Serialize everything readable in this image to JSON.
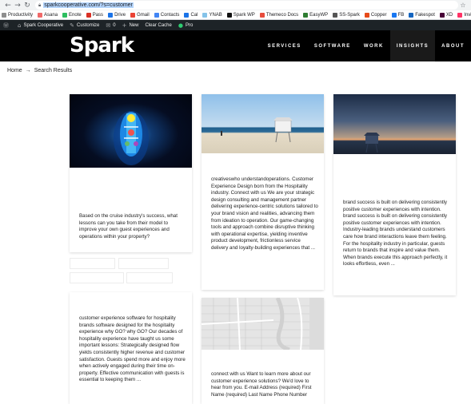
{
  "browser": {
    "url": "sparkcooperative.com/?s=customer"
  },
  "bookmarks": [
    {
      "label": "Productivity",
      "color": "#8e8e8e"
    },
    {
      "label": "Asana",
      "color": "#f06a6a"
    },
    {
      "label": "Enote",
      "color": "#2dbe60"
    },
    {
      "label": "Pass",
      "color": "#d93025"
    },
    {
      "label": "Drive",
      "color": "#1a73e8"
    },
    {
      "label": "Gmail",
      "color": "#ea4335"
    },
    {
      "label": "Contacts",
      "color": "#4285f4"
    },
    {
      "label": "Cal",
      "color": "#1a73e8"
    },
    {
      "label": "YNAB",
      "color": "#85c3e9"
    },
    {
      "label": "Spark WP",
      "color": "#111111"
    },
    {
      "label": "Themeco Docs",
      "color": "#e74c3c"
    },
    {
      "label": "EasyWP",
      "color": "#2e7d32"
    },
    {
      "label": "SS-Spark",
      "color": "#555555"
    },
    {
      "label": "Copper",
      "color": "#e64a19"
    },
    {
      "label": "FB",
      "color": "#1877f2"
    },
    {
      "label": "Fakespot",
      "color": "#1565c0"
    },
    {
      "label": "XD",
      "color": "#470137"
    },
    {
      "label": "Invision",
      "color": "#ff3366"
    }
  ],
  "adminbar": {
    "site": "Spark Cooperative",
    "customize": "Customize",
    "comments": "0",
    "new": "New",
    "clear_cache": "Clear Cache",
    "pro": "Pro"
  },
  "site": {
    "logo": "Spark",
    "nav": [
      "SERVICES",
      "SOFTWARE",
      "WORK",
      "INSIGHTS",
      "ABOUT"
    ],
    "active_nav": "INSIGHTS"
  },
  "breadcrumb": {
    "home": "Home",
    "sep": "→",
    "current": "Search Results"
  },
  "cards": {
    "c1": "Based on the cruise industry's success, what lessons can you take from their model to improve your own guest experiences and operations within your property?",
    "c2": "creativeswho understandoperations.  Customer Experience Design born from the Hospitality industry. Connect with us We are your strategic design consulting and management partner delivering experience-centric solutions tailored to your brand vision and realities, advancing them from ideation to operation. Our game-changing tools and approach combine disruptive thinking with operational expertise, yielding inventive product development, frictionless service delivery and loyalty-building experiences that ...",
    "c3": "brand success is built on delivering consistently positive customer experiences with intention. brand success is built on delivering consistently positive customer experiences with intention. Industry-leading brands understand customers care how brand interactions leave them feeling. For the hospitality industry in particular, guests return to brands that inspire and value them. When brands execute this approach perfectly, it looks effortless, even ...",
    "c4": " customer experience software for hospitality brands software designed for the hospitality experience why GO? why GO? Our decades of hospitality experience have taught us some important lessons: Strategically designed flow yields consistently higher revenue and customer satisfaction.  Guests spend more and enjoy more when actively engaged during their time on-property. Effective communication with guests is essential to keeping them ...",
    "c5": "connect with us Want to learn more about our customer experience solutions? We'd love to hear from you.  E-mail Address (required) First Name (required) Last Name Phone Number"
  }
}
